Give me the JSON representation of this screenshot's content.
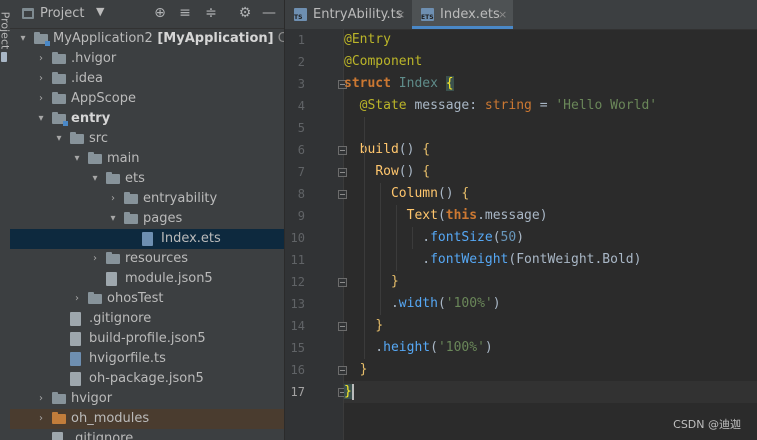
{
  "left_strip": {
    "label": "Project"
  },
  "project_panel": {
    "title": "Project",
    "tree": [
      {
        "label": "MyApplication2",
        "bold_suffix": "[MyApplication]",
        "path": "C:\\Us",
        "kind": "module-folder",
        "expanded": true
      },
      {
        "label": ".hvigor",
        "kind": "folder",
        "expanded": false
      },
      {
        "label": ".idea",
        "kind": "folder",
        "expanded": false
      },
      {
        "label": "AppScope",
        "kind": "folder",
        "expanded": false
      },
      {
        "label": "entry",
        "kind": "module-folder",
        "expanded": true,
        "bold": true
      },
      {
        "label": "src",
        "kind": "folder",
        "expanded": true
      },
      {
        "label": "main",
        "kind": "folder",
        "expanded": true
      },
      {
        "label": "ets",
        "kind": "folder",
        "expanded": true
      },
      {
        "label": "entryability",
        "kind": "folder",
        "expanded": false
      },
      {
        "label": "pages",
        "kind": "folder",
        "expanded": true
      },
      {
        "label": "Index.ets",
        "kind": "ets-file",
        "selected": true
      },
      {
        "label": "resources",
        "kind": "folder",
        "expanded": false
      },
      {
        "label": "module.json5",
        "kind": "json-file"
      },
      {
        "label": "ohosTest",
        "kind": "folder",
        "expanded": false
      },
      {
        "label": ".gitignore",
        "kind": "file"
      },
      {
        "label": "build-profile.json5",
        "kind": "json-file"
      },
      {
        "label": "hvigorfile.ts",
        "kind": "ts-file"
      },
      {
        "label": "oh-package.json5",
        "kind": "json-file"
      },
      {
        "label": "hvigor",
        "kind": "folder",
        "expanded": false
      },
      {
        "label": "oh_modules",
        "kind": "excluded-folder",
        "expanded": false
      },
      {
        "label": ".gitignore",
        "kind": "file"
      }
    ]
  },
  "tabs": [
    {
      "label": "EntryAbility.ts",
      "badge": "TS",
      "close": "×",
      "active": false
    },
    {
      "label": "Index.ets",
      "badge": "ETS",
      "close": "×",
      "active": true
    }
  ],
  "editor": {
    "current_line": 17,
    "lines": [
      [
        [
          "ann",
          "@Entry"
        ]
      ],
      [
        [
          "ann",
          "@Component"
        ]
      ],
      [
        [
          "kwb",
          "struct "
        ],
        [
          "type",
          "Index "
        ],
        [
          "bracehl",
          "{"
        ]
      ],
      [
        [
          "plain",
          "  "
        ],
        [
          "ann",
          "@State "
        ],
        [
          "plain",
          "message: "
        ],
        [
          "kw",
          "string "
        ],
        [
          "plain",
          "= "
        ],
        [
          "str",
          "'Hello World'"
        ]
      ],
      [],
      [
        [
          "plain",
          "  "
        ],
        [
          "fn",
          "build"
        ],
        [
          "plain",
          "() "
        ],
        [
          "brace",
          "{"
        ]
      ],
      [
        [
          "plain",
          "    "
        ],
        [
          "fn",
          "Row"
        ],
        [
          "plain",
          "() "
        ],
        [
          "brace",
          "{"
        ]
      ],
      [
        [
          "plain",
          "      "
        ],
        [
          "fn",
          "Column"
        ],
        [
          "plain",
          "() "
        ],
        [
          "brace",
          "{"
        ]
      ],
      [
        [
          "plain",
          "        "
        ],
        [
          "fn",
          "Text"
        ],
        [
          "plain",
          "("
        ],
        [
          "kwb",
          "this"
        ],
        [
          "plain",
          ".message)"
        ]
      ],
      [
        [
          "plain",
          "          ."
        ],
        [
          "meth",
          "fontSize"
        ],
        [
          "plain",
          "("
        ],
        [
          "num",
          "50"
        ],
        [
          "plain",
          ")"
        ]
      ],
      [
        [
          "plain",
          "          ."
        ],
        [
          "meth",
          "fontWeight"
        ],
        [
          "plain",
          "(FontWeight.Bold)"
        ]
      ],
      [
        [
          "plain",
          "      "
        ],
        [
          "brace",
          "}"
        ]
      ],
      [
        [
          "plain",
          "      ."
        ],
        [
          "meth",
          "width"
        ],
        [
          "plain",
          "("
        ],
        [
          "str",
          "'100%'"
        ],
        [
          "plain",
          ")"
        ]
      ],
      [
        [
          "plain",
          "    "
        ],
        [
          "brace",
          "}"
        ]
      ],
      [
        [
          "plain",
          "    ."
        ],
        [
          "meth",
          "height"
        ],
        [
          "plain",
          "("
        ],
        [
          "str",
          "'100%'"
        ],
        [
          "plain",
          ")"
        ]
      ],
      [
        [
          "plain",
          "  "
        ],
        [
          "brace",
          "}"
        ]
      ],
      [
        [
          "bracehl",
          "}"
        ]
      ]
    ]
  },
  "watermark": "CSDN @迪迦",
  "colors": {
    "accent": "#4a88c7",
    "selection": "#0d293e",
    "background": "#2b2b2b",
    "panel": "#3c3f41"
  }
}
